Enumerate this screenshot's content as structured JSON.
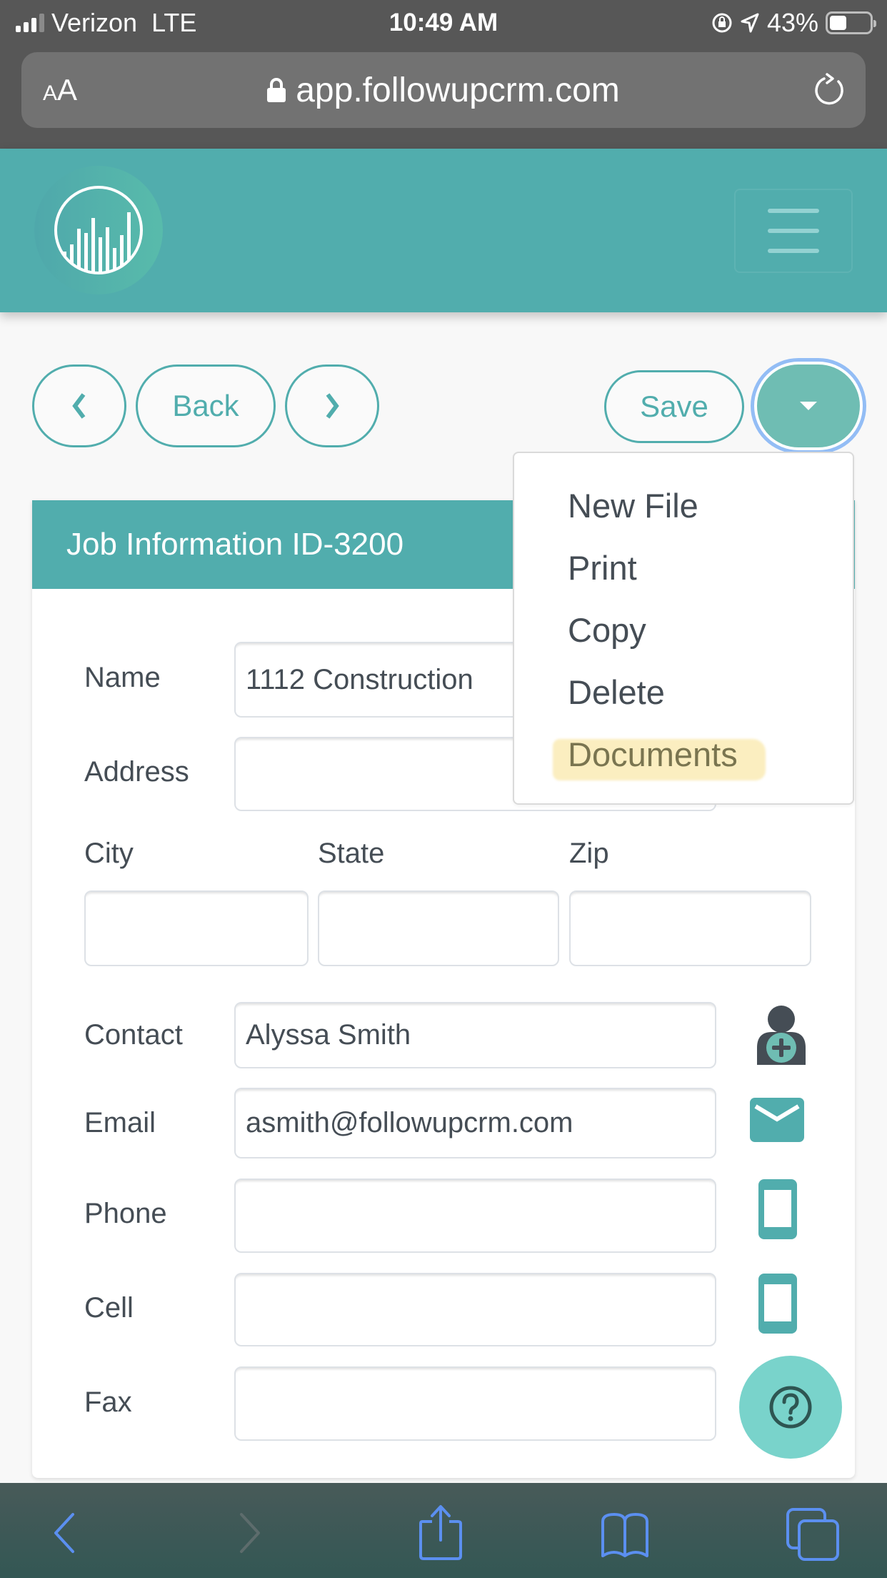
{
  "status_bar": {
    "carrier": "Verizon",
    "network": "LTE",
    "time": "10:49 AM",
    "battery_percent": "43%",
    "battery_level": 0.43
  },
  "browser": {
    "text_size_label_small": "A",
    "text_size_label_large": "A",
    "url": "app.followupcrm.com"
  },
  "toolbar": {
    "back_label": "Back",
    "save_label": "Save"
  },
  "menu": {
    "items": [
      {
        "label": "New File"
      },
      {
        "label": "Print"
      },
      {
        "label": "Copy"
      },
      {
        "label": "Delete"
      },
      {
        "label": "Documents",
        "highlighted": true
      }
    ]
  },
  "card": {
    "title": "Job Information ID-3200"
  },
  "form": {
    "name": {
      "label": "Name",
      "value": "1112 Construction"
    },
    "address": {
      "label": "Address",
      "value": ""
    },
    "city": {
      "label": "City",
      "value": ""
    },
    "state": {
      "label": "State",
      "value": ""
    },
    "zip": {
      "label": "Zip",
      "value": ""
    },
    "contact": {
      "label": "Contact",
      "value": "Alyssa Smith"
    },
    "email": {
      "label": "Email",
      "value": "asmith@followupcrm.com"
    },
    "phone": {
      "label": "Phone",
      "value": ""
    },
    "cell": {
      "label": "Cell",
      "value": ""
    },
    "fax": {
      "label": "Fax",
      "value": ""
    }
  },
  "colors": {
    "brand_teal": "#51adad",
    "button_fill": "#6fbdb3",
    "focus_ring": "#93bdf5",
    "help_button": "#79d3cb",
    "highlight": "#fbeec0",
    "ios_blue": "#5b8ff0"
  }
}
